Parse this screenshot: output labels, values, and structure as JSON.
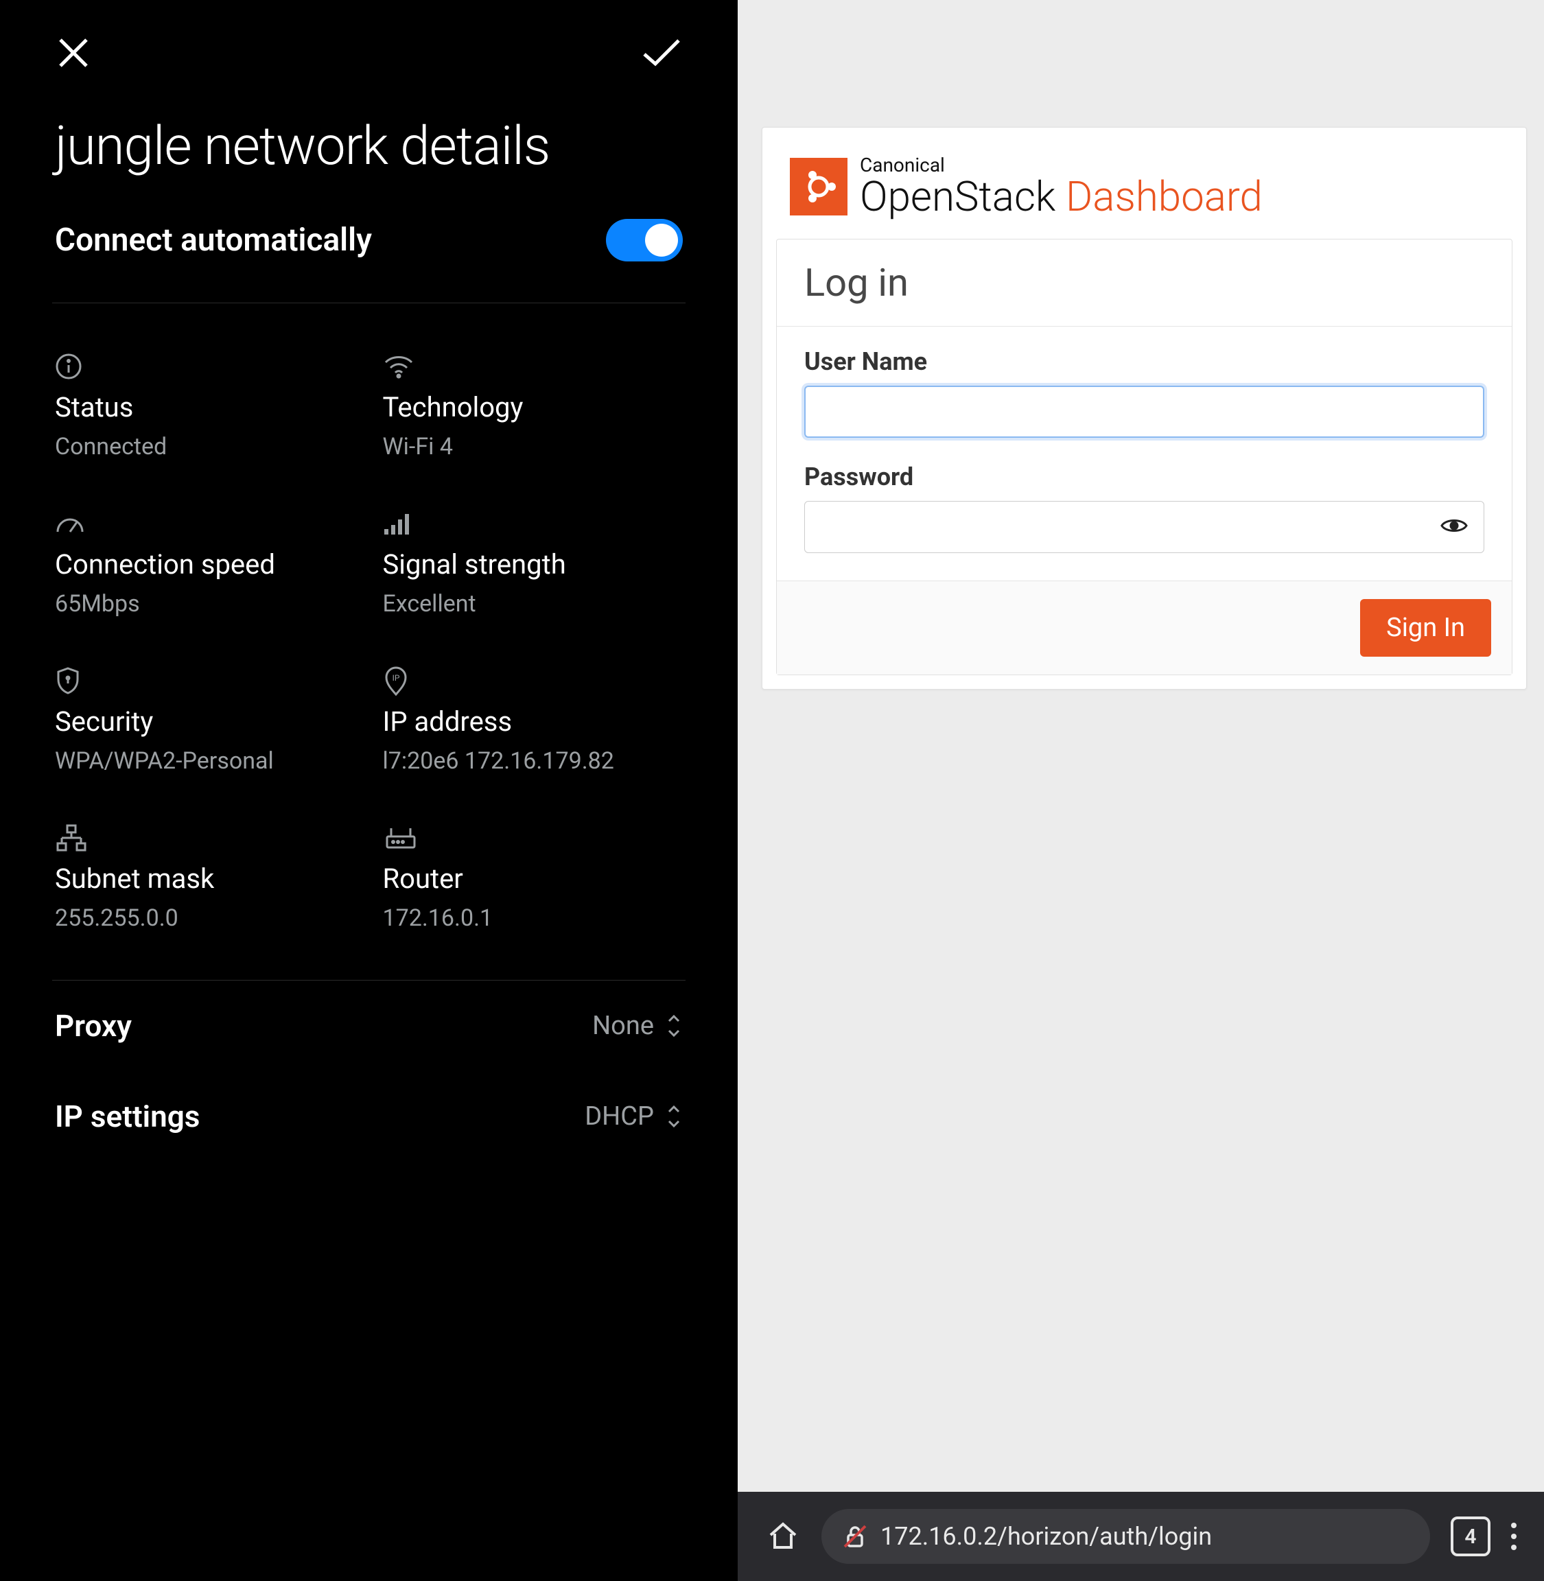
{
  "left": {
    "title": "jungle network details",
    "auto_label": "Connect automatically",
    "auto_on": true,
    "stats": [
      {
        "icon": "info",
        "label": "Status",
        "value": "Connected"
      },
      {
        "icon": "wifi",
        "label": "Technology",
        "value": "Wi-Fi 4"
      },
      {
        "icon": "speed",
        "label": "Connection speed",
        "value": "65Mbps"
      },
      {
        "icon": "signal",
        "label": "Signal strength",
        "value": "Excellent"
      },
      {
        "icon": "shield",
        "label": "Security",
        "value": "WPA/WPA2-Personal"
      },
      {
        "icon": "ip",
        "label": "IP address",
        "value": "l7:20e6 172.16.179.82"
      },
      {
        "icon": "subnet",
        "label": "Subnet mask",
        "value": "255.255.0.0"
      },
      {
        "icon": "router",
        "label": "Router",
        "value": "172.16.0.1"
      }
    ],
    "proxy_label": "Proxy",
    "proxy_value": "None",
    "ip_settings_label": "IP settings",
    "ip_settings_value": "DHCP"
  },
  "right": {
    "brand_small": "Canonical",
    "brand_main1": "OpenStack ",
    "brand_main2": "Dashboard",
    "login_title": "Log in",
    "username_label": "User Name",
    "username_value": "",
    "password_label": "Password",
    "password_value": "",
    "signin_label": "Sign In",
    "home_icon": "home",
    "address": "172.16.0.2/horizon/auth/login",
    "tab_count": "4"
  }
}
